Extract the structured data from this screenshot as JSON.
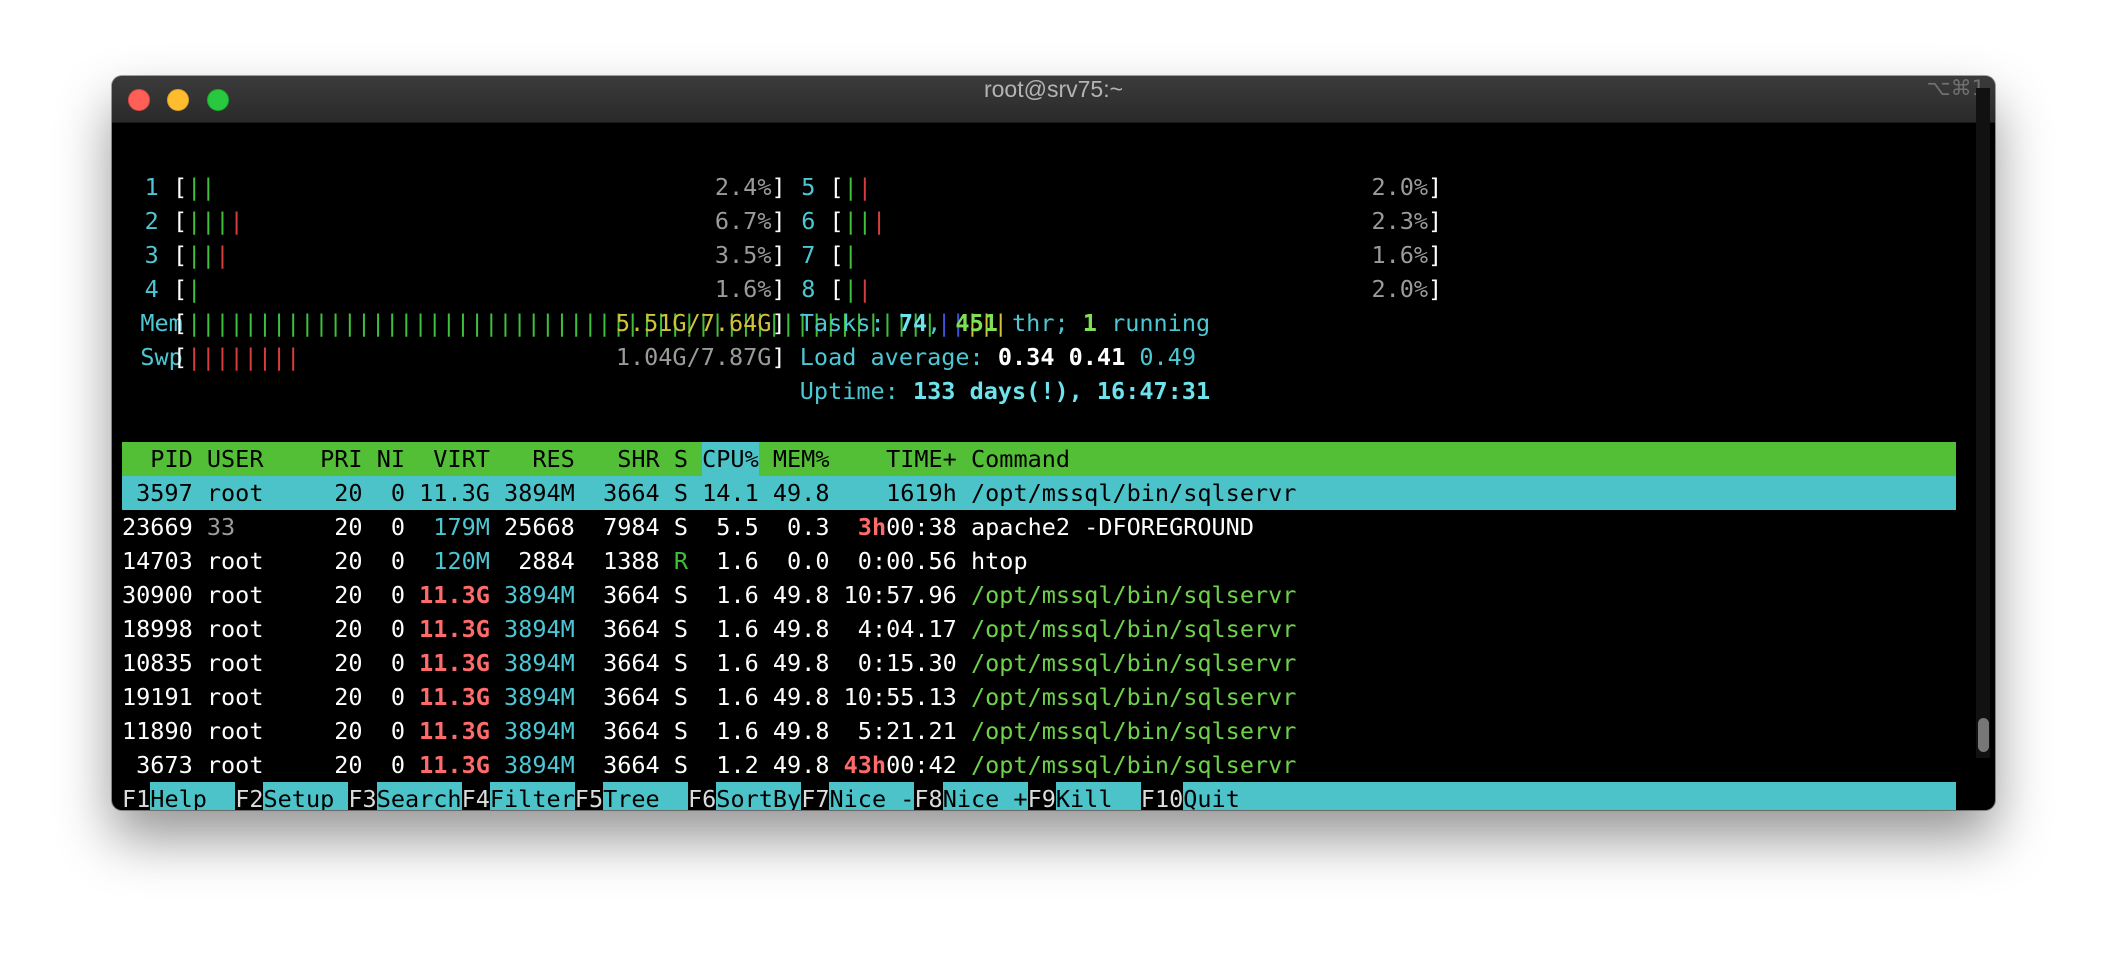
{
  "window": {
    "title": "root@srv75:~",
    "shortcut": "⌥⌘1"
  },
  "cpus": [
    {
      "id": "1",
      "bars": [
        [
          "g",
          "||"
        ]
      ],
      "pct": "2.4%"
    },
    {
      "id": "2",
      "bars": [
        [
          "g",
          "|||"
        ],
        [
          "r",
          "|"
        ]
      ],
      "pct": "6.7%"
    },
    {
      "id": "3",
      "bars": [
        [
          "g",
          "||"
        ],
        [
          "r",
          "|"
        ]
      ],
      "pct": "3.5%"
    },
    {
      "id": "4",
      "bars": [
        [
          "g",
          "|"
        ]
      ],
      "pct": "1.6%"
    },
    {
      "id": "5",
      "bars": [
        [
          "g",
          "|"
        ],
        [
          "r",
          "|"
        ]
      ],
      "pct": "2.0%"
    },
    {
      "id": "6",
      "bars": [
        [
          "g",
          "||"
        ],
        [
          "r",
          "|"
        ]
      ],
      "pct": "2.3%"
    },
    {
      "id": "7",
      "bars": [
        [
          "g",
          "|"
        ]
      ],
      "pct": "1.6%"
    },
    {
      "id": "8",
      "bars": [
        [
          "g",
          "|"
        ],
        [
          "r",
          "|"
        ]
      ],
      "pct": "2.0%"
    }
  ],
  "mem": {
    "label": "Mem",
    "bars": [
      [
        "g",
        "|||||||||||||||||||||||||||||||||||||||||||||||||||||"
      ],
      [
        "b",
        "||"
      ],
      [
        "y",
        "|||"
      ]
    ],
    "value": "5.51G/7.64G"
  },
  "swp": {
    "label": "Swp",
    "bars": [
      [
        "r",
        "||||||||"
      ]
    ],
    "value": "1.04G/7.87G"
  },
  "tasks": {
    "label": "Tasks:",
    "count": "74",
    "thr": "451",
    "thr_label": "thr;",
    "running": "1",
    "running_label": "running"
  },
  "load": {
    "label": "Load average:",
    "v1": "0.34",
    "v5": "0.41",
    "v15": "0.49"
  },
  "uptime": {
    "label": "Uptime:",
    "value": "133 days(!), 16:47:31"
  },
  "columns": [
    "PID",
    "USER",
    "PRI",
    "NI",
    "VIRT",
    "RES",
    "SHR",
    "S",
    "CPU%",
    "MEM%",
    "TIME+",
    "Command"
  ],
  "processes": [
    {
      "pid": "3597",
      "user": "root",
      "pri": "20",
      "ni": "0",
      "virt": "11.3G",
      "res": "3894M",
      "shr": "3664",
      "s": "S",
      "cpu": "14.1",
      "mem": "49.8",
      "time_h": "",
      "time": "1619h",
      "cmd": "/opt/mssql/bin/sqlservr",
      "selected": true
    },
    {
      "pid": "23669",
      "user": "33",
      "pri": "20",
      "ni": "0",
      "virt": "179M",
      "res": "25668",
      "shr": "7984",
      "s": "S",
      "cpu": "5.5",
      "mem": "0.3",
      "time_h": "3h",
      "time": "00:38",
      "cmd": "apache2 -DFOREGROUND"
    },
    {
      "pid": "14703",
      "user": "root",
      "pri": "20",
      "ni": "0",
      "virt": "120M",
      "res": "2884",
      "shr": "1388",
      "s": "R",
      "cpu": "1.6",
      "mem": "0.0",
      "time_h": "",
      "time": "0:00.56",
      "cmd": "htop"
    },
    {
      "pid": "30900",
      "user": "root",
      "pri": "20",
      "ni": "0",
      "virt": "11.3G",
      "res": "3894M",
      "shr": "3664",
      "s": "S",
      "cpu": "1.6",
      "mem": "49.8",
      "time_h": "",
      "time": "10:57.96",
      "cmd": "/opt/mssql/bin/sqlservr"
    },
    {
      "pid": "18998",
      "user": "root",
      "pri": "20",
      "ni": "0",
      "virt": "11.3G",
      "res": "3894M",
      "shr": "3664",
      "s": "S",
      "cpu": "1.6",
      "mem": "49.8",
      "time_h": "",
      "time": "4:04.17",
      "cmd": "/opt/mssql/bin/sqlservr"
    },
    {
      "pid": "10835",
      "user": "root",
      "pri": "20",
      "ni": "0",
      "virt": "11.3G",
      "res": "3894M",
      "shr": "3664",
      "s": "S",
      "cpu": "1.6",
      "mem": "49.8",
      "time_h": "",
      "time": "0:15.30",
      "cmd": "/opt/mssql/bin/sqlservr"
    },
    {
      "pid": "19191",
      "user": "root",
      "pri": "20",
      "ni": "0",
      "virt": "11.3G",
      "res": "3894M",
      "shr": "3664",
      "s": "S",
      "cpu": "1.6",
      "mem": "49.8",
      "time_h": "",
      "time": "10:55.13",
      "cmd": "/opt/mssql/bin/sqlservr"
    },
    {
      "pid": "11890",
      "user": "root",
      "pri": "20",
      "ni": "0",
      "virt": "11.3G",
      "res": "3894M",
      "shr": "3664",
      "s": "S",
      "cpu": "1.6",
      "mem": "49.8",
      "time_h": "",
      "time": "5:21.21",
      "cmd": "/opt/mssql/bin/sqlservr"
    },
    {
      "pid": "3673",
      "user": "root",
      "pri": "20",
      "ni": "0",
      "virt": "11.3G",
      "res": "3894M",
      "shr": "3664",
      "s": "S",
      "cpu": "1.2",
      "mem": "49.8",
      "time_h": "43h",
      "time": "00:42",
      "cmd": "/opt/mssql/bin/sqlservr"
    }
  ],
  "footer": [
    {
      "key": "F1",
      "label": "Help  "
    },
    {
      "key": "F2",
      "label": "Setup "
    },
    {
      "key": "F3",
      "label": "Search"
    },
    {
      "key": "F4",
      "label": "Filter"
    },
    {
      "key": "F5",
      "label": "Tree  "
    },
    {
      "key": "F6",
      "label": "SortBy"
    },
    {
      "key": "F7",
      "label": "Nice -"
    },
    {
      "key": "F8",
      "label": "Nice +"
    },
    {
      "key": "F9",
      "label": "Kill  "
    },
    {
      "key": "F10",
      "label": "Quit"
    }
  ]
}
